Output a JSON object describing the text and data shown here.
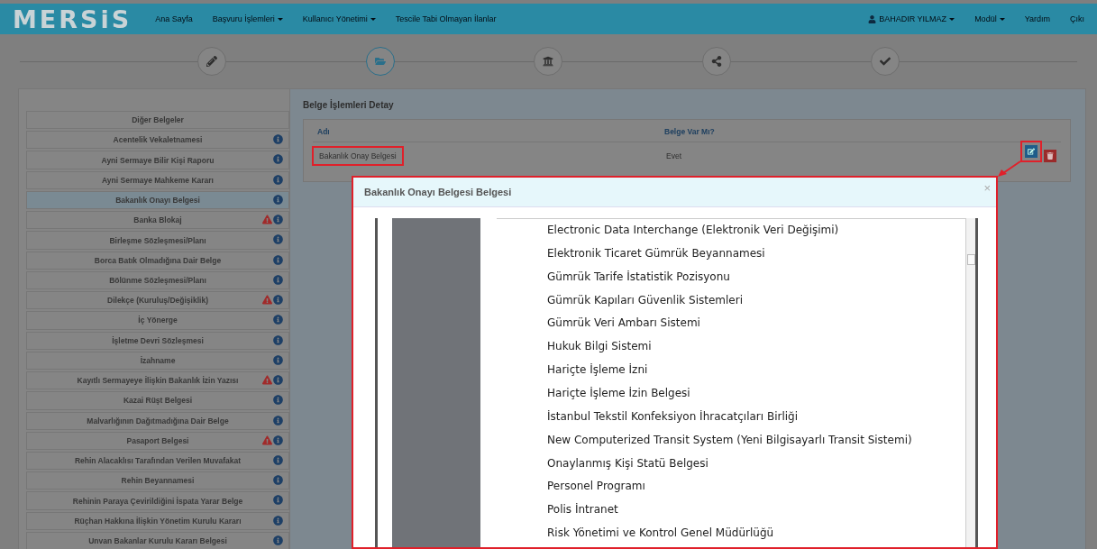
{
  "navbar": {
    "logo": "MERSiS",
    "left_items": [
      {
        "label": "Ana Sayfa",
        "has_menu": false
      },
      {
        "label": "Başvuru İşlemleri",
        "has_menu": true
      },
      {
        "label": "Kullanıcı Yönetimi",
        "has_menu": true
      },
      {
        "label": "Tescile Tabi Olmayan İlanlar",
        "has_menu": false
      }
    ],
    "user": {
      "label": "BAHADIR YILMAZ",
      "has_menu": true
    },
    "right_items": [
      {
        "label": "Modül",
        "has_menu": true
      },
      {
        "label": "Yardım",
        "has_menu": false
      },
      {
        "label": "Çıkı",
        "has_menu": false
      }
    ]
  },
  "steps": [
    {
      "selected": false
    },
    {
      "selected": true
    },
    {
      "selected": false
    },
    {
      "selected": false
    },
    {
      "selected": false
    }
  ],
  "sidebar": {
    "items": [
      {
        "label": "Diğer Belgeler",
        "kind": "header",
        "selected": false
      },
      {
        "label": "Acentelik Vekaletnamesi",
        "kind": "document",
        "selected": false,
        "warning": false
      },
      {
        "label": "Ayni Sermaye Bilir Kişi Raporu",
        "kind": "document",
        "selected": false,
        "warning": false
      },
      {
        "label": "Ayni Sermaye Mahkeme Kararı",
        "kind": "document",
        "selected": false,
        "warning": false
      },
      {
        "label": "Bakanlık Onayı Belgesi",
        "kind": "document",
        "selected": true,
        "warning": false
      },
      {
        "label": "Banka Blokaj",
        "kind": "document",
        "selected": false,
        "warning": true
      },
      {
        "label": "Birleşme Sözleşmesi/Planı",
        "kind": "document",
        "selected": false,
        "warning": false
      },
      {
        "label": "Borca Batık Olmadığına Dair Belge",
        "kind": "document",
        "selected": false,
        "warning": false
      },
      {
        "label": "Bölünme Sözleşmesi/Planı",
        "kind": "document",
        "selected": false,
        "warning": false
      },
      {
        "label": "Dilekçe (Kuruluş/Değişiklik)",
        "kind": "document",
        "selected": false,
        "warning": true
      },
      {
        "label": "İç Yönerge",
        "kind": "document",
        "selected": false,
        "warning": false
      },
      {
        "label": "İşletme Devri Sözleşmesi",
        "kind": "document",
        "selected": false,
        "warning": false
      },
      {
        "label": "İzahname",
        "kind": "document",
        "selected": false,
        "warning": false
      },
      {
        "label": "Kayıtlı Sermayeye İlişkin Bakanlık İzin Yazısı",
        "kind": "document",
        "selected": false,
        "warning": true
      },
      {
        "label": "Kazai Rüşt Belgesi",
        "kind": "document",
        "selected": false,
        "warning": false
      },
      {
        "label": "Malvarlığının Dağıtmadığına Dair Belge",
        "kind": "document",
        "selected": false,
        "warning": false
      },
      {
        "label": "Pasaport Belgesi",
        "kind": "document",
        "selected": false,
        "warning": true
      },
      {
        "label": "Rehin Alacaklısı Tarafından Verilen Muvafakat",
        "kind": "document",
        "selected": false,
        "warning": false
      },
      {
        "label": "Rehin Beyannamesi",
        "kind": "document",
        "selected": false,
        "warning": false
      },
      {
        "label": "Rehinin Paraya Çevirildiğini İspata Yarar Belge",
        "kind": "document",
        "selected": false,
        "warning": false
      },
      {
        "label": "Rüçhan Hakkına İlişkin Yönetim Kurulu Kararı",
        "kind": "document",
        "selected": false,
        "warning": false
      },
      {
        "label": "Unvan Bakanlar Kurulu Kararı Belgesi",
        "kind": "document",
        "selected": false,
        "warning": false
      }
    ]
  },
  "detail": {
    "title": "Belge İşlemleri Detay",
    "columns": [
      "Adı",
      "Belge Var Mı?"
    ],
    "rows": [
      {
        "cells": [
          "Bakanlık Onay Belgesi",
          "Evet"
        ],
        "highlighted": true,
        "edit_highlighted": true
      }
    ]
  },
  "modal": {
    "title": "Bakanlık Onayı Belgesi Belgesi",
    "close": "×",
    "highlighted": true,
    "document_lines": [
      "Electronic Data Interchange (Elektronik Veri Değişimi)",
      "Elektronik Ticaret Gümrük Beyannamesi",
      "Gümrük Tarife İstatistik Pozisyonu",
      "Gümrük Kapıları Güvenlik Sistemleri",
      "Gümrük Veri Ambarı Sistemi",
      "Hukuk Bilgi Sistemi",
      "Hariçte İşleme İzni",
      "Hariçte İşleme İzin Belgesi",
      "İstanbul Tekstil Konfeksiyon İhracatçıları Birliği",
      "New Computerized Transit System (Yeni Bilgisayarlı Transit Sistemi)",
      "Onaylanmış Kişi Statü Belgesi",
      "Personel Programı",
      "Polis İntranet",
      "Risk Yönetimi ve Kontrol Genel Müdürlüğü"
    ]
  }
}
